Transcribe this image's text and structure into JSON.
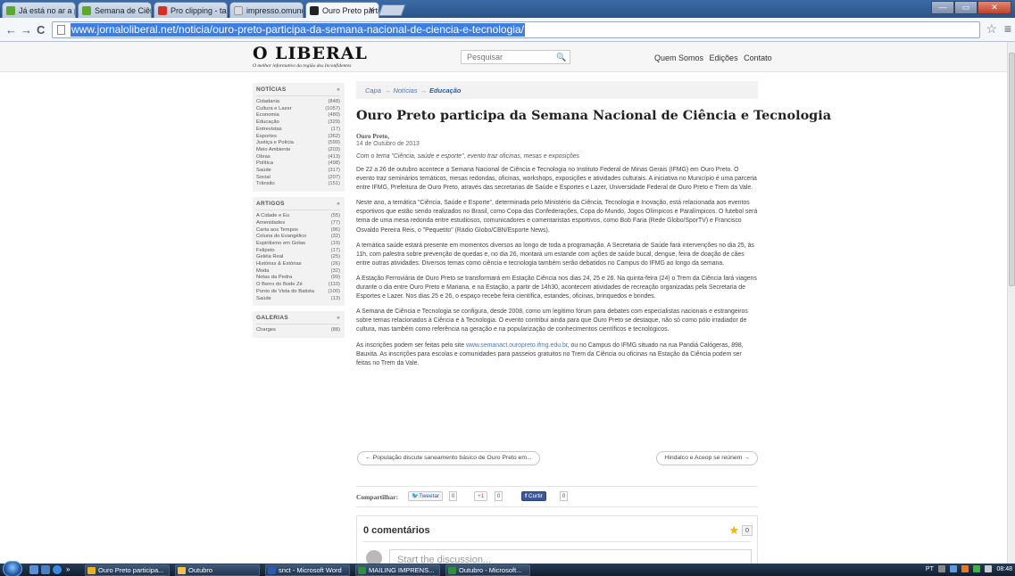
{
  "browser": {
    "tabs": [
      {
        "label": "Já está no ar a página da ...",
        "icon": "green-site-icon",
        "color": "#5aa82c",
        "active": false
      },
      {
        "label": "Semana de Ciência e Tecno...",
        "icon": "green-site-icon",
        "color": "#5aa82c",
        "active": false
      },
      {
        "label": "Pro clipping - tabana.tole...",
        "icon": "gmail-icon",
        "color": "#d93025",
        "active": false
      },
      {
        "label": "impresso.omundodosinco...",
        "icon": "page-icon",
        "color": "#dddddd",
        "active": false
      },
      {
        "label": "Ouro Preto participa da Se...",
        "icon": "site-l-icon",
        "color": "#222222",
        "active": true
      }
    ],
    "url": "www.jornaloliberal.net/noticia/ouro-preto-participa-da-semana-nacional-de-ciencia-e-tecnologia/",
    "nav": {
      "back": "←",
      "forward": "→",
      "reload": "C"
    },
    "star": "☆",
    "menu": "≡",
    "window": {
      "min": "—",
      "max": "▭",
      "close": "✕"
    }
  },
  "site": {
    "logo": "O LIBERAL",
    "tagline": "O melhor informativo da região dos Inconfidentes",
    "search_placeholder": "Pesquisar",
    "search_icon": "🔍",
    "nav": [
      "Quem Somos",
      "Edições",
      "Contato"
    ]
  },
  "sidebar": {
    "noticias": {
      "title": "NOTÍCIAS",
      "arrow": "»",
      "items": [
        {
          "label": "Cidadania",
          "count": "(848)"
        },
        {
          "label": "Cultura e Lazer",
          "count": "(1057)"
        },
        {
          "label": "Economia",
          "count": "(480)"
        },
        {
          "label": "Educação",
          "count": "(329)"
        },
        {
          "label": "Entrevistas",
          "count": "(17)"
        },
        {
          "label": "Esportes",
          "count": "(362)"
        },
        {
          "label": "Justiça e Polícia",
          "count": "(599)"
        },
        {
          "label": "Meio Ambiente",
          "count": "(203)"
        },
        {
          "label": "Obras",
          "count": "(413)"
        },
        {
          "label": "Política",
          "count": "(498)"
        },
        {
          "label": "Saúde",
          "count": "(317)"
        },
        {
          "label": "Social",
          "count": "(207)"
        },
        {
          "label": "Trânsito",
          "count": "(151)"
        }
      ]
    },
    "artigos": {
      "title": "ARTIGOS",
      "arrow": "»",
      "items": [
        {
          "label": "A Cidade e Eu",
          "count": "(55)"
        },
        {
          "label": "Amenidades",
          "count": "(77)"
        },
        {
          "label": "Carta aos Tempos",
          "count": "(96)"
        },
        {
          "label": "Coluna do Evangélico",
          "count": "(32)"
        },
        {
          "label": "Espiritismo em Gotas",
          "count": "(19)"
        },
        {
          "label": "Felipeto",
          "count": "(17)"
        },
        {
          "label": "Geléia Real",
          "count": "(25)"
        },
        {
          "label": "Histórias & Estórias",
          "count": "(26)"
        },
        {
          "label": "Moda",
          "count": "(32)"
        },
        {
          "label": "Notas da Pedra",
          "count": "(99)"
        },
        {
          "label": "O Berro do Bode Zé",
          "count": "(110)"
        },
        {
          "label": "Ponto de Vista do Batista",
          "count": "(100)"
        },
        {
          "label": "Saúde",
          "count": "(13)"
        }
      ]
    },
    "galerias": {
      "title": "GALERIAS",
      "arrow": "»",
      "items": [
        {
          "label": "Charges",
          "count": "(88)"
        }
      ]
    }
  },
  "breadcrumb": {
    "items": [
      "Capa",
      "Notícias"
    ],
    "current": "Educação",
    "sep": "→"
  },
  "article": {
    "title": "Ouro Preto participa da Semana Nacional de Ciência e Tecnologia",
    "city": "Ouro Preto,",
    "date": "14 de Outubro de 2013",
    "lead": "Com o tema \"Ciência, saúde e esporte\", evento traz oficinas, mesas e exposições",
    "paragraphs": [
      "De 22 a 26 de outubro acontece a Semana Nacional de Ciência e Tecnologia no Instituto Federal de Minas Gerais (IFMG) em Ouro Preto. O evento traz seminários temáticos, mesas redondas, oficinas, workshops, exposições e atividades culturais. A iniciativa no Município é uma parceria entre IFMG, Prefeitura de Ouro Preto, através das secretarias de Saúde e Esportes e Lazer, Universidade Federal de Ouro Preto e Trem da Vale.",
      "Neste ano, a temática \"Ciência, Saúde e Esporte\", determinada pelo Ministério da Ciência, Tecnologia e Inovação, está relacionada aos eventos esportivos que estão sendo realizados no Brasil, como Copa das Confederações, Copa do Mundo, Jogos Olímpicos e Paralímpicos. O futebol será tema de uma mesa redonda entre estudiosos, comunicadores e comentaristas esportivos, como Bob Faria (Rede Globo/SporTV) e Francisco Osvaldo Pereira Reis, o \"Pequetito\" (Rádio Globo/CBN/Esporte News).",
      "A temática saúde estará presente em momentos diversos ao longo de toda a programação. A Secretaria de Saúde fará intervenções no dia 25, às 11h, com palestra sobre prevenção de quedas e, no dia 26, montará um estande com ações de saúde bucal, dengue, feira de doação de cães entre outras atividades. Diversos temas como ciência e tecnologia também serão debatidos no Campus do IFMG ao longo da semana.",
      "A Estação Ferroviária de Ouro Preto se transformará em Estação Ciência nos dias 24, 25 e 26. Na quinta-feira (24) o Trem da Ciência fará viagens durante o dia entre Ouro Preto e Mariana, e na Estação, a partir de 14h30, acontecem atividades de recreação organizadas pela Secretaria de Esportes e Lazer. Nos dias 25 e 26, o espaço recebe feira científica, estandes, oficinas, brinquedos e brindes.",
      "A Semana de Ciência e Tecnologia se configura, desde 2008, como um legítimo fórum para debates com especialistas nacionais e estrangeiros sobre temas relacionados à Ciência e à Tecnologia. O evento contribui ainda para que Ouro Preto se destaque, não só como pólo irradiador de cultura, mas também como referência na geração e na popularização de conhecimentos científicos e tecnológicos."
    ],
    "last_para": {
      "before": "As inscrições podem ser feitas pelo site ",
      "link": "www.semanact.ouropreto.ifmg.edu.br",
      "after": ", ou no Campus do IFMG situado na rua Pandiá Calógeras, 898, Bauxita. As inscrições para escolas e comunidades para passeios gratuitos no Trem da Ciência ou oficinas na Estação da Ciência podem ser feitas no Trem da Vale."
    }
  },
  "post_nav": {
    "prev": "← População discute saneamento básico de Ouro Preto em...",
    "next": "Hindalco e Aceop se reúnem →"
  },
  "share": {
    "label": "Compartilhar:",
    "tweet": "Tweetar",
    "tweet_count": "0",
    "gplus": "+1",
    "gplus_count": "0",
    "fb": "Curtir",
    "fb_count": "0"
  },
  "comments": {
    "title": "0 comentários",
    "count": "0",
    "placeholder": "Start the discussion..."
  },
  "taskbar": {
    "items": [
      {
        "label": "Ouro Preto participa...",
        "color": "#e8b02a"
      },
      {
        "label": "Outubro",
        "color": "#f0c24a"
      },
      {
        "label": "snct - Microsoft Word",
        "color": "#2a5db0"
      },
      {
        "label": "MAILING IMPRENS...",
        "color": "#2f8f3e"
      },
      {
        "label": "Outubro - Microsoft...",
        "color": "#2f8f3e"
      }
    ],
    "lang": "PT",
    "clock": "08:48"
  }
}
